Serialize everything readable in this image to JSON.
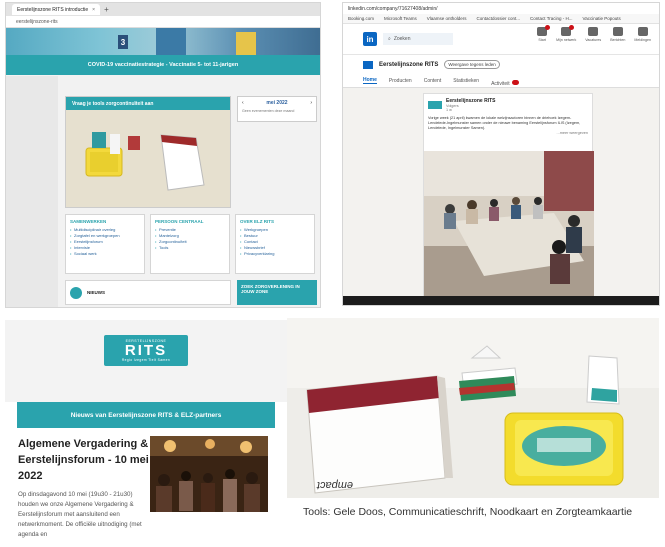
{
  "website": {
    "tab_title": "Eerstelijnszone RITS introductie",
    "tab_close": "×",
    "new_tab": "+",
    "url": "eerstelijnszone-rits",
    "hero_number": "3",
    "banner": "COVID-19 vaccinatiestrategie - Vaccinatie 5- tot 11-jarigen",
    "ask_title": "Vraag je tools zorgcontinuïteit aan",
    "calendar": {
      "prev": "‹",
      "month": "mei 2022",
      "next": "›",
      "note": "Geen evenementen deze maand"
    },
    "cards": [
      {
        "title": "SAMENWERKEN",
        "items": [
          "Multidisciplinair overleg",
          "Zorgtafel en werkgroepen",
          "Eerstelijnsforum",
          "Intervisie",
          "Sociaal werk"
        ]
      },
      {
        "title": "PERSOON CENTRAAL",
        "items": [
          "Preventie",
          "Mantelzorg",
          "Zorgcontinuïteit",
          "Tools"
        ]
      },
      {
        "title": "OVER ELZ RITS",
        "items": [
          "Werkgroepen",
          "Bestuur",
          "Contact",
          "Nieuwsbrief",
          "Privacyverklaring"
        ]
      }
    ],
    "news_label": "NIEUWS",
    "zoek_label": "ZOEK ZORGVERLENING IN JOUW ZONE"
  },
  "linkedin": {
    "url": "linkedin.com/company/71627408/admin/",
    "bookmarks": [
      "Booking.com",
      "Microsoft Teams",
      "Vlaamse ontholders",
      "Contactdossier cont...",
      "Contact Tracing - H...",
      "Vaccinatie Popouts"
    ],
    "logo": "in",
    "search_placeholder": "Zoeken",
    "nav": [
      "Start",
      "Mijn netwerk",
      "Vacatures",
      "Berichten",
      "Meldingen"
    ],
    "page_name": "Eerstelijnszone RITS",
    "view_as_member": "Weergave tegens leden",
    "tabs": [
      "Home",
      "Producten",
      "Content",
      "Statistieken",
      "Activiteit"
    ],
    "post_author": "Eerstelijnszone RITS",
    "post_sub": "Volgers",
    "post_time": "1 w",
    "post_text": "Vorige week (21 april) kwamen de lokale welzijnsactoren binnen de driehoek Izegem-Lendelede-Ingelmunster samen onder de nieuwe benaming Eerstelijnsforum ILIS (Izegem, Lendelede, Ingelmunster Samen).",
    "post_more": "...meer weergeven"
  },
  "newsletter": {
    "logo_top": "EERSTELIJNSZONE",
    "logo_big": "RITS",
    "logo_sub": "Regio Izegem Tielt Samen",
    "bar": "Nieuws van Eerstelijnszone RITS & ELZ-partners",
    "title": "Algemene Vergadering & Eerstelijnsforum - 10 mei 2022",
    "body": "Op dinsdagavond 10 mei (19u30 - 21u30) houden we onze Algemene Vergadering & Eerstelijnsforum met aansluitend een netwerkmoment. De officiële uitnodiging (met agenda en"
  },
  "photo": {
    "book_brand": "empact"
  },
  "caption": "Tools: Gele Doos, Communicatieschrift, Noodkaart en Zorgteamkaartie"
}
